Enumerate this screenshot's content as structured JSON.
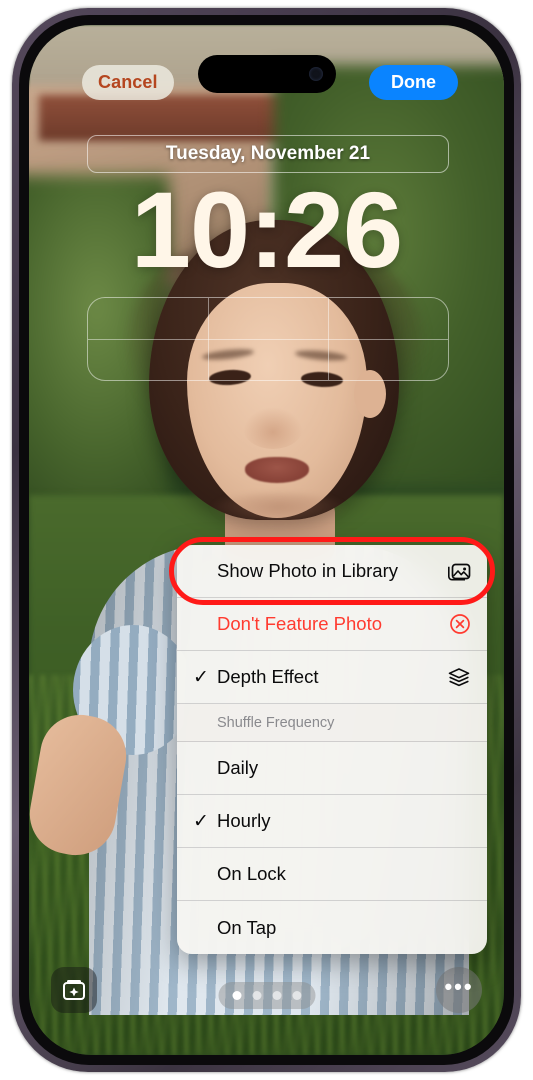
{
  "device": {
    "name": "iphone-14-pro",
    "frame_color": "#4b4150"
  },
  "lockscreen": {
    "cancel_label": "Cancel",
    "done_label": "Done",
    "date": "Tuesday, November 21",
    "time": "10:26",
    "accent_done": "#0a84ff",
    "accent_cancel": "#b5461f",
    "page_dots": 4,
    "active_dot_index": 0,
    "photo_chip_icon": "photo-sparkle-icon",
    "more_chip_label": "•••"
  },
  "context_menu": {
    "items": [
      {
        "id": "show-photo-in-library",
        "label": "Show Photo in Library",
        "checked": false,
        "destructive": false,
        "trailing_icon": "photo-library-icon",
        "highlighted": true
      },
      {
        "id": "dont-feature-photo",
        "label": "Don't Feature Photo",
        "checked": false,
        "destructive": true,
        "trailing_icon": "x-circle-icon",
        "highlighted": false
      },
      {
        "id": "depth-effect",
        "label": "Depth Effect",
        "checked": true,
        "destructive": false,
        "trailing_icon": "layers-icon",
        "highlighted": false
      }
    ],
    "section_header": "Shuffle Frequency",
    "frequency_options": [
      {
        "id": "daily",
        "label": "Daily",
        "checked": false
      },
      {
        "id": "hourly",
        "label": "Hourly",
        "checked": true
      },
      {
        "id": "on-lock",
        "label": "On Lock",
        "checked": false
      },
      {
        "id": "on-tap",
        "label": "On Tap",
        "checked": false
      }
    ],
    "checkmark_glyph": "✓"
  },
  "annotation": {
    "highlight_color": "#ff1a18",
    "target": "show-photo-in-library"
  }
}
